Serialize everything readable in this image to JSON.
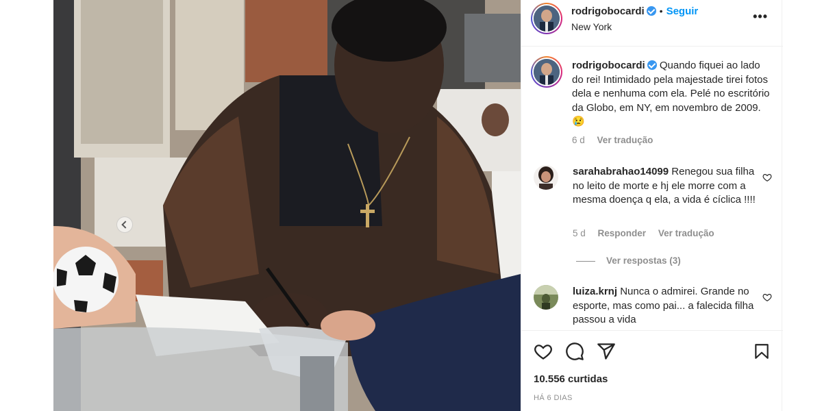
{
  "post": {
    "username": "rodrigobocardi",
    "follow_label": "Seguir",
    "location": "New York",
    "more_label": "•••"
  },
  "caption": {
    "username": "rodrigobocardi",
    "text": "Quando fiquei ao lado do rei! Intimidado pela majestade tirei fotos dela e nenhuma com ela. Pelé no escritório da Globo, em NY, em novembro de 2009. 😢",
    "time": "6 d",
    "translate_label": "Ver tradução"
  },
  "comments": [
    {
      "username": "sarahabrahao14099",
      "text": "Renegou sua filha no leito de morte e hj ele morre com a mesma doença q ela, a vida é cíclica !!!!",
      "time": "5 d",
      "reply_label": "Responder",
      "translate_label": "Ver tradução",
      "replies_label": "Ver respostas (3)"
    },
    {
      "username": "luiza.krnj",
      "text": "Nunca o admirei. Grande no esporte, mas como pai... a falecida filha passou a vida"
    }
  ],
  "likes_label": "10.556 curtidas",
  "posted_label": "HÁ 6 DIAS",
  "colors": {
    "accent": "#0095f6",
    "text": "#262626",
    "muted": "#8e8e8e",
    "verified": "#3897f0"
  },
  "icons": [
    "verified-badge-icon",
    "more-options-icon",
    "heart-icon",
    "comment-icon",
    "share-icon",
    "bookmark-icon",
    "carousel-prev-icon"
  ]
}
